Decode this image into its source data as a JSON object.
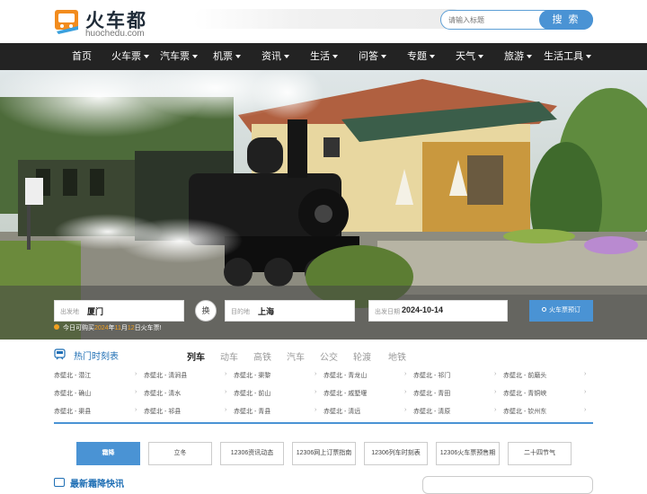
{
  "header": {
    "logo_text": "火车都",
    "logo_sub": "huochedu.com",
    "search_placeholder": "请输入标题",
    "search_button": "搜 索"
  },
  "nav": [
    {
      "label": "首页",
      "dropdown": false
    },
    {
      "label": "火车票",
      "dropdown": true
    },
    {
      "label": "汽车票",
      "dropdown": true
    },
    {
      "label": "机票",
      "dropdown": true
    },
    {
      "label": "资讯",
      "dropdown": true
    },
    {
      "label": "生活",
      "dropdown": true
    },
    {
      "label": "问答",
      "dropdown": true
    },
    {
      "label": "专题",
      "dropdown": true
    },
    {
      "label": "天气",
      "dropdown": true
    },
    {
      "label": "旅游",
      "dropdown": true
    },
    {
      "label": "生活工具",
      "dropdown": true
    }
  ],
  "query": {
    "from_label": "出发地",
    "from_value": "厦门",
    "swap_label": "换",
    "to_label": "目的地",
    "to_value": "上海",
    "date_label": "出发日期",
    "date_value": "2024-10-14",
    "submit_label": "火车票预订"
  },
  "tip": {
    "prefix": "今日可购买",
    "year": "2024",
    "year_suffix": "年",
    "month": "11",
    "month_suffix": "月",
    "day": "12",
    "suffix": "日火车票!"
  },
  "timetable": {
    "title": "热门时刻表",
    "tabs": [
      "列车",
      "动车",
      "高铁",
      "汽车",
      "公交",
      "轮渡",
      "地铁"
    ],
    "active_tab": 0,
    "routes": [
      [
        "赤壁北 - 潜江",
        "赤壁北 - 清涧县",
        "赤壁北 - 渠黎",
        "赤壁北 - 青龙山",
        "赤壁北 - 祁门",
        "赤壁北 - 前磨头"
      ],
      [
        "赤壁北 - 确山",
        "赤壁北 - 清水",
        "赤壁北 - 前山",
        "赤壁北 - 戚墅堰",
        "赤壁北 - 青田",
        "赤壁北 - 青铜峡"
      ],
      [
        "赤壁北 - 渠县",
        "赤壁北 - 祁县",
        "赤壁北 - 青县",
        "赤壁北 - 清远",
        "赤壁北 - 清原",
        "赤壁北 - 钦州东"
      ]
    ]
  },
  "festivals": {
    "items": [
      "霜降",
      "立冬",
      "12306资讯动态",
      "12306网上订票指南",
      "12306列车时刻表",
      "12306火车票预售期",
      "二十四节气"
    ],
    "active": 0
  },
  "bottom": {
    "title": "最新霜降快讯"
  },
  "colors": {
    "accent": "#4a93d4",
    "nav_bg": "#232323",
    "highlight": "#f0a020",
    "title_blue": "#1f6fb5"
  }
}
